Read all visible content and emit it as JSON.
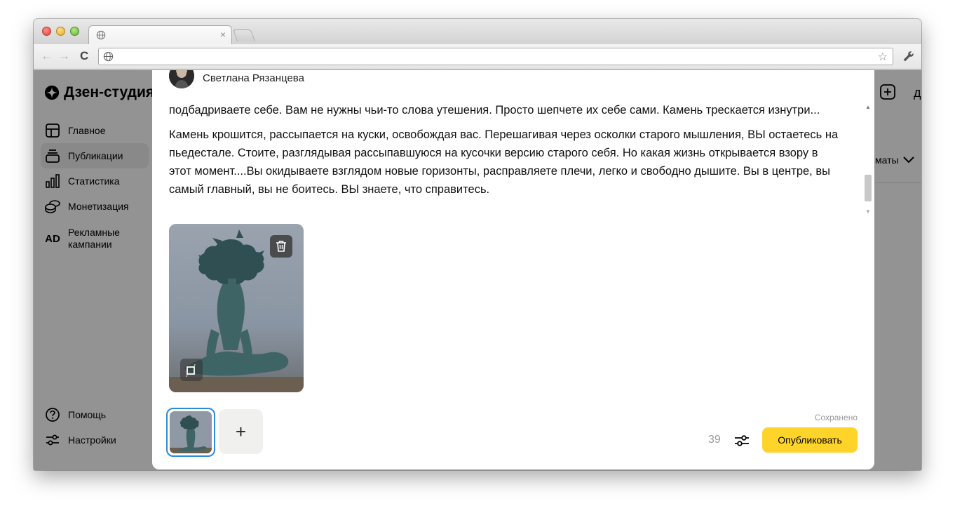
{
  "browser": {
    "tab_close": "×",
    "back": "←",
    "forward": "→",
    "reload": "C",
    "star": "☆",
    "wrench": "🔧"
  },
  "sidebar": {
    "logo": "Дзен-студия",
    "items": [
      {
        "label": "Главное",
        "icon": "dashboard-icon"
      },
      {
        "label": "Публикации",
        "icon": "publications-icon",
        "active": true
      },
      {
        "label": "Статистика",
        "icon": "bar-chart-icon"
      },
      {
        "label": "Монетизация",
        "icon": "coins-icon"
      },
      {
        "label": "Рекламные кампании",
        "icon": "ad-icon",
        "icon_text": "AD"
      }
    ],
    "bottom_items": [
      {
        "label": "Помощь",
        "icon": "help-icon"
      },
      {
        "label": "Настройки",
        "icon": "settings-icon"
      }
    ]
  },
  "right_panel": {
    "filter_label": "маты",
    "cut_char": "д"
  },
  "editor": {
    "author": "Светлана Рязанцева",
    "paragraphs": [
      "подбадриваете себе. Вам не нужны чьи-то слова утешения. Просто шепчете их себе сами. Камень трескается изнутри...",
      "Камень крошится, рассыпается на куски, освобождая вас. Перешагивая через осколки старого мышления,  ВЫ остаетесь на пьедестале. Стоите, разглядывая рассыпавшуюся на кусочки версию старого себя. Но какая жизнь открывается взору в этот момент....Вы окидываете взглядом новые горизонты, расправляете плечи, легко и свободно дышите. Вы в центре, вы самый главный, вы не боитесь. ВЫ знаете, что справитесь."
    ],
    "add_media": "+",
    "status": "Сохранено",
    "char_count": "39",
    "publish_label": "Опубликовать"
  },
  "colors": {
    "accent_yellow": "#fed42b",
    "thumb_border": "#2a8cdb"
  }
}
